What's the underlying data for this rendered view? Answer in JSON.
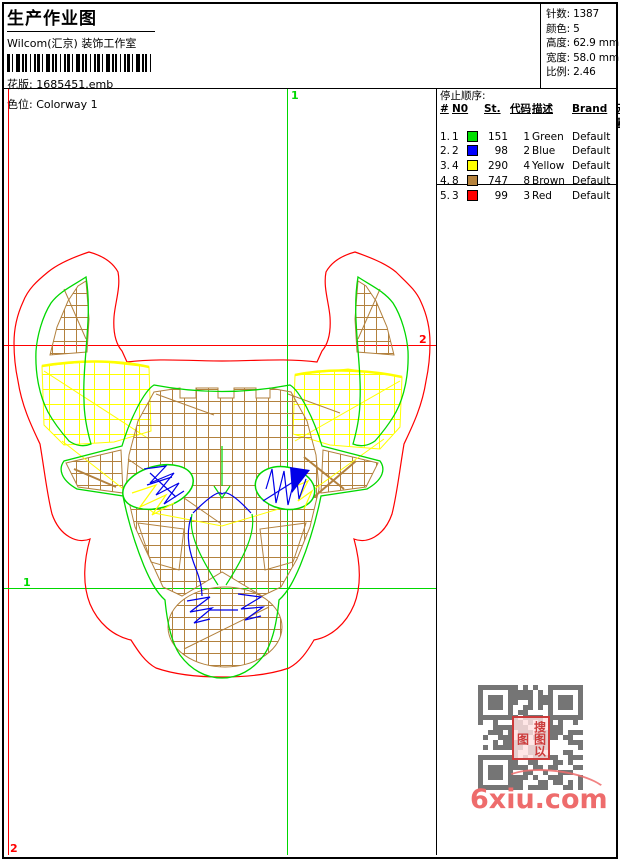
{
  "header": {
    "title": "生产作业图",
    "company": "Wilcom(汇京) 装饰工作室",
    "design_file": {
      "label": "花版:",
      "value": "1685451.emb"
    },
    "colorway": {
      "label": "色位:",
      "value": "Colorway 1"
    },
    "stats": [
      {
        "label": "针数:",
        "value": "1387"
      },
      {
        "label": "颜色:",
        "value": "5"
      },
      {
        "label": "高度:",
        "value": "62.9 mm"
      },
      {
        "label": "宽度:",
        "value": "58.0 mm"
      },
      {
        "label": "比例:",
        "value": "2.46"
      }
    ]
  },
  "stop_sequence": {
    "title": "停止顺序:",
    "columns": [
      "#",
      "N0",
      "St.",
      "代码",
      "描述",
      "Brand",
      "元素"
    ],
    "rows": [
      {
        "num": "1.",
        "n0": "1",
        "hex": "#00E000",
        "st": "151",
        "code": "1",
        "desc": "Green",
        "brand": "Default",
        "element": ""
      },
      {
        "num": "2.",
        "n0": "2",
        "hex": "#0000FF",
        "st": "98",
        "code": "2",
        "desc": "Blue",
        "brand": "Default",
        "element": ""
      },
      {
        "num": "3.",
        "n0": "4",
        "hex": "#FFFF00",
        "st": "290",
        "code": "4",
        "desc": "Yellow",
        "brand": "Default",
        "element": ""
      },
      {
        "num": "4.",
        "n0": "8",
        "hex": "#B5823C",
        "st": "747",
        "code": "8",
        "desc": "Brown",
        "brand": "Default",
        "element": ""
      },
      {
        "num": "5.",
        "n0": "3",
        "hex": "#FF0000",
        "st": "99",
        "code": "3",
        "desc": "Red",
        "brand": "Default",
        "element": ""
      }
    ]
  },
  "canvas": {
    "start_marker": "1",
    "end_marker": "2",
    "thread_colors": {
      "green": "#00D800",
      "blue": "#0000E8",
      "yellow": "#FFFF00",
      "brown": "#B2813E",
      "red": "#FF0000"
    }
  },
  "footer": {
    "watermark": "6xiu.com",
    "qr_seal_text": "搜图以图"
  }
}
